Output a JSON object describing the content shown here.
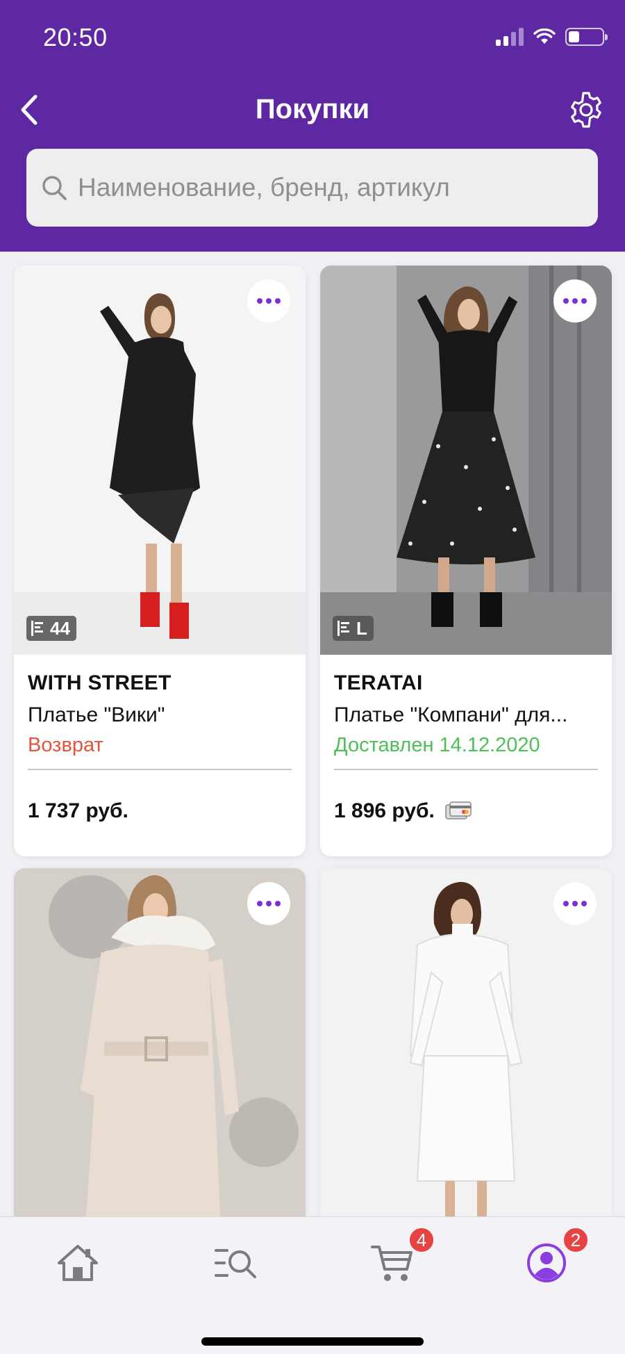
{
  "status_bar": {
    "time": "20:50"
  },
  "header": {
    "title": "Покупки"
  },
  "search": {
    "placeholder": "Наименование, бренд, артикул"
  },
  "products": [
    {
      "brand": "WITH STREET",
      "name": "Платье \"Вики\"",
      "status": "Возврат",
      "status_color": "#e5533d",
      "price": "1 737 руб.",
      "size": "44",
      "has_card_icon": false
    },
    {
      "brand": "TERATAI",
      "name": "Платье \"Компани\" для...",
      "status": "Доставлен 14.12.2020",
      "status_color": "#4cbf5a",
      "price": "1 896 руб.",
      "size": "L",
      "has_card_icon": true
    },
    {
      "brand": "",
      "name": "",
      "status": "",
      "price": "",
      "size": ""
    },
    {
      "brand": "",
      "name": "",
      "status": "",
      "price": "",
      "size": ""
    }
  ],
  "tabbar": {
    "items": [
      {
        "icon": "home-icon"
      },
      {
        "icon": "catalog-search-icon"
      },
      {
        "icon": "cart-icon",
        "badge": "4"
      },
      {
        "icon": "profile-icon",
        "badge": "2"
      }
    ]
  },
  "colors": {
    "brand": "#5e28a2",
    "accent": "#7b2fd8",
    "badge": "#e84242",
    "return": "#e5533d",
    "delivered": "#4cbf5a"
  }
}
